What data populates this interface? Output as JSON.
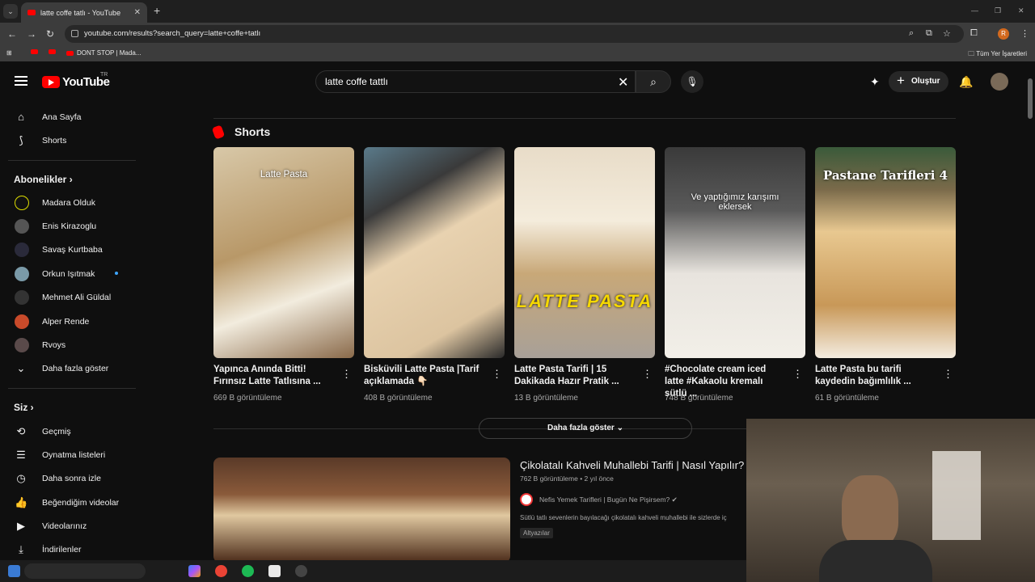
{
  "browser": {
    "tab_title": "latte coffe tatlı - YouTube",
    "url": "youtube.com/results?search_query=latte+coffe+tatlı",
    "bookmark_label": "DONT STOP | Mada...",
    "all_bookmarks": "Tüm Yer İşaretleri",
    "profile_initial": "R"
  },
  "masthead": {
    "logo": "YouTube",
    "country": "TR",
    "search_value": "latte coffe tattlı",
    "create_label": "Oluştur"
  },
  "sidebar": {
    "home": "Ana Sayfa",
    "shorts": "Shorts",
    "subs_heading": "Abonelikler",
    "subscriptions": [
      "Madara Olduk",
      "Enis Kirazoglu",
      "Savaş Kurtbaba",
      "Orkun Işıtmak",
      "Mehmet Ali Güldal",
      "Alper Rende",
      "Rvoys"
    ],
    "show_more": "Daha fazla göster",
    "you_heading": "Siz",
    "you_items": [
      "Geçmiş",
      "Oynatma listeleri",
      "Daha sonra izle",
      "Beğendiğim videolar",
      "Videolarınız",
      "İndirilenler"
    ]
  },
  "results": {
    "shorts_heading": "Shorts",
    "shorts": [
      {
        "title": "Yapınca Anında Bitti! Fırınsız Latte Tatlısına ...",
        "views": "669 B görüntüleme",
        "overlay": "Latte Pasta"
      },
      {
        "title": "Bisküvili Latte Pasta |Tarif açıklamada 👇🏻",
        "views": "408 B görüntüleme",
        "overlay": ""
      },
      {
        "title": "Latte Pasta Tarifi | 15 Dakikada Hazır Pratik ...",
        "views": "13 B görüntüleme",
        "overlay": "LATTE PASTA"
      },
      {
        "title": "#Chocolate cream iced latte #Kakaolu kremalı sütlü ...",
        "views": "748 B görüntüleme",
        "overlay": "Ve yaptığımız karışımı eklersek"
      },
      {
        "title": "Latte Pasta bu tarifi kaydedin bağımlılık ...",
        "views": "61 B görüntüleme",
        "overlay": "Pastane Tarifleri 4"
      }
    ],
    "show_more": "Daha fazla göster",
    "video": {
      "title": "Çikolatalı Kahveli Muhallebi Tarifi | Nasıl Yapılır?",
      "meta": "762 B görüntüleme • 2 yıl önce",
      "channel": "Nefis Yemek Tarifleri | Bugün Ne Pişirsem? ✔",
      "description": "Sütlü tatlı sevenlerin bayılacağı çikolatalı kahveli muhallebi ile sizlerde iç",
      "badge": "Altyazılar"
    }
  }
}
